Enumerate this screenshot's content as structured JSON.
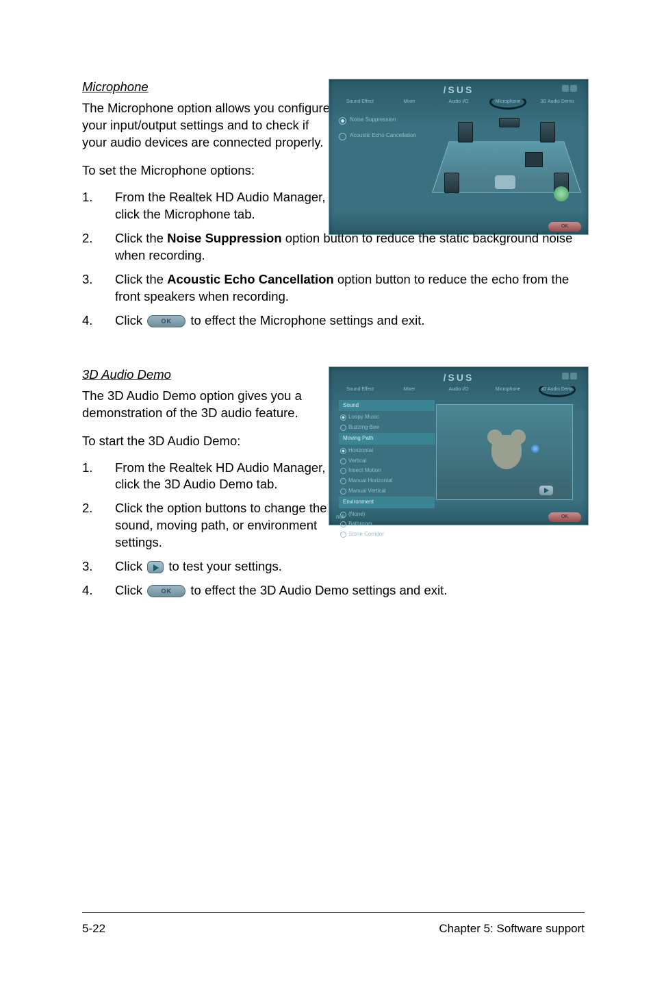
{
  "microphone": {
    "heading": "Microphone",
    "intro": "The Microphone option allows you configure your input/output settings and to check if your audio devices are connected properly.",
    "to_line": "To set the Microphone options:",
    "steps": {
      "s1": "From the Realtek HD Audio Manager, click the Microphone tab.",
      "s2a": "Click the ",
      "s2b": "Noise Suppression",
      "s2c": " option button to reduce the static background noise when recording.",
      "s3a": "Click the ",
      "s3b": "Acoustic Echo Cancellation",
      "s3c": " option button to reduce the echo from the front speakers when recording.",
      "s4a": "Click ",
      "s4b": " to effect the Microphone settings and exit."
    },
    "screenshot": {
      "brand": "/SUS",
      "tabs": [
        "Sound Effect",
        "Mixer",
        "Audio I/O",
        "Microphone",
        "3D Audio Demo"
      ],
      "active_tab_index": 3,
      "options": [
        "Noise Suppression",
        "Acoustic Echo Cancellation"
      ],
      "bottom_left": "",
      "ok": "OK"
    }
  },
  "demo3d": {
    "heading": "3D Audio Demo",
    "intro": "The 3D Audio Demo option gives you a demonstration of the 3D audio feature.",
    "to_line": "To start the 3D Audio Demo:",
    "steps": {
      "s1": "From the Realtek HD Audio Manager, click the 3D Audio Demo tab.",
      "s2": "Click the option buttons to change the sound, moving path, or environment settings.",
      "s3a": "Click ",
      "s3b": " to test your settings.",
      "s4a": "Click ",
      "s4b": " to effect the 3D Audio Demo settings and exit."
    },
    "screenshot": {
      "brand": "/SUS",
      "tabs": [
        "Sound Effect",
        "Mixer",
        "Audio I/O",
        "Microphone",
        "3D Audio Demo"
      ],
      "active_tab_index": 4,
      "groups": {
        "sound_head": "Sound",
        "sound_items": [
          "Loopy Music",
          "Buzzing Bee"
        ],
        "path_head": "Moving Path",
        "path_items": [
          "Horizontal",
          "Vertical",
          "Insect Motion",
          "Manual Horizontal",
          "Manual Vertical"
        ],
        "env_head": "Environment",
        "env_items": [
          "(None)",
          "Bathroom",
          "Stone Corridor"
        ]
      },
      "bottom_left": "null",
      "ok": "OK"
    }
  },
  "inline_buttons": {
    "ok_label": "OK"
  },
  "footer": {
    "left": "5-22",
    "right": "Chapter 5: Software support"
  }
}
